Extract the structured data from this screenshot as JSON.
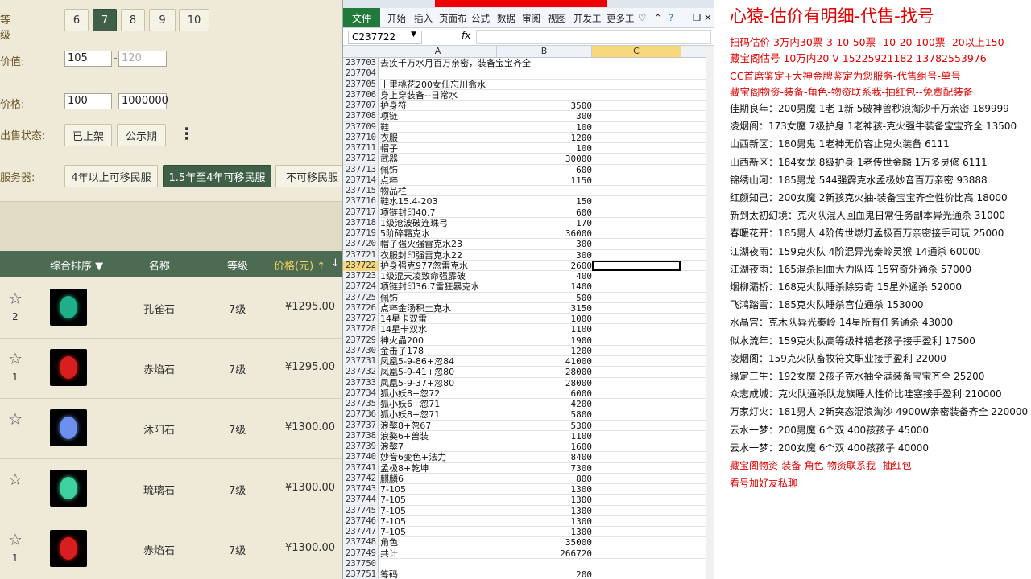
{
  "filters": {
    "level_label": "等级",
    "level_options": [
      "6",
      "7",
      "8",
      "9",
      "10"
    ],
    "level_selected": "7",
    "value_label": "价值:",
    "value_min": "105",
    "value_max_placeholder": "120",
    "price_label": "价格:",
    "price_min": "100",
    "price_max": "1000000",
    "sale_status_label": "出售状态:",
    "sale_status_options": [
      "已上架",
      "公示期"
    ],
    "more_icon": "vertical-dots-icon",
    "server_label": "服务器:",
    "server_options": [
      "4年以上可移民服",
      "1.5年至4年可移民服",
      "不可移民服"
    ],
    "server_selected": "1.5年至4年可移民服",
    "range_separator": "-"
  },
  "table": {
    "headers": {
      "sort": "综合排序",
      "name": "名称",
      "level": "等级",
      "price": "价格(元)"
    },
    "rows": [
      {
        "fav_count": "2",
        "name": "孔雀石",
        "level": "7级",
        "price": "¥1295.00",
        "gem_color": "#1fae8a"
      },
      {
        "fav_count": "1",
        "name": "赤焰石",
        "level": "7级",
        "price": "¥1295.00",
        "gem_color": "#d81e1e"
      },
      {
        "fav_count": "",
        "name": "沐阳石",
        "level": "7级",
        "price": "¥1300.00",
        "gem_color": "#6c8ff0"
      },
      {
        "fav_count": "",
        "name": "琉璃石",
        "level": "7级",
        "price": "¥1300.00",
        "gem_color": "#3fd0a0"
      },
      {
        "fav_count": "1",
        "name": "赤焰石",
        "level": "7级",
        "price": "¥1300.00",
        "gem_color": "#d81e1e"
      }
    ]
  },
  "excel": {
    "ribbon_tabs": [
      "文件",
      "开始",
      "插入",
      "页面布",
      "公式",
      "数据",
      "审阅",
      "视图",
      "开发工",
      "更多工"
    ],
    "name_box": "C237722",
    "fx": "fx",
    "columns": [
      "A",
      "B",
      "C"
    ],
    "active_row": "237722",
    "rows": [
      [
        "237703",
        "去疾千万水月百万亲密，装备宝宝齐全",
        ""
      ],
      [
        "237704",
        "",
        ""
      ],
      [
        "237705",
        "十里桃花200女仙忘川翕水",
        ""
      ],
      [
        "237706",
        "身上穿装备--日常水",
        ""
      ],
      [
        "237707",
        "护身符",
        "3500"
      ],
      [
        "237708",
        "项链",
        "300"
      ],
      [
        "237709",
        "鞋",
        "100"
      ],
      [
        "237710",
        "衣服",
        "1200"
      ],
      [
        "237711",
        "帽子",
        "100"
      ],
      [
        "237712",
        "武器",
        "30000"
      ],
      [
        "237713",
        "佩饰",
        "600"
      ],
      [
        "237714",
        "点粹",
        "1150"
      ],
      [
        "237715",
        "物品栏",
        ""
      ],
      [
        "237716",
        "鞋水15.4-203",
        "150"
      ],
      [
        "237717",
        "项链封印40.7",
        "600"
      ],
      [
        "237718",
        "1级沧波破连珠弓",
        "170"
      ],
      [
        "237719",
        "5阶碎霜克水",
        "36000"
      ],
      [
        "237720",
        "帽子强火强雷克水23",
        "300"
      ],
      [
        "237721",
        "衣服封印强雷克水22",
        "300"
      ],
      [
        "237722",
        "护身强克977忽雷克水",
        "2600"
      ],
      [
        "237723",
        "1级混天凌致命强霹破",
        "400"
      ],
      [
        "237724",
        "项链封印36.7雷狂暴克水",
        "1400"
      ],
      [
        "237725",
        "佩饰",
        "500"
      ],
      [
        "237726",
        "点粹金汤积土克水",
        "3150"
      ],
      [
        "237727",
        "14星卡双雷",
        "1000"
      ],
      [
        "237728",
        "14星卡双水",
        "1100"
      ],
      [
        "237729",
        "神火畾200",
        "1900"
      ],
      [
        "237730",
        "金击子178",
        "1200"
      ],
      [
        "237731",
        "凤凰5-9-86+忽84",
        "41000"
      ],
      [
        "237732",
        "凤凰5-9-41+忽80",
        "28000"
      ],
      [
        "237733",
        "凤凰5-9-37+忽80",
        "28000"
      ],
      [
        "237734",
        "狐小妖8+忽72",
        "6000"
      ],
      [
        "237735",
        "狐小妖6+忽71",
        "4200"
      ],
      [
        "237736",
        "狐小妖8+忽71",
        "5800"
      ],
      [
        "237737",
        "浪獒8+忽67",
        "5300"
      ],
      [
        "237738",
        "浪獒6+兽装",
        "1100"
      ],
      [
        "237739",
        "浪獒7",
        "1600"
      ],
      [
        "237740",
        "妙音6变色+法力",
        "8400"
      ],
      [
        "237741",
        "孟极8+乾坤",
        "7300"
      ],
      [
        "237742",
        "麒麟6",
        "800"
      ],
      [
        "237743",
        "7-105",
        "1300"
      ],
      [
        "237744",
        "7-105",
        "1300"
      ],
      [
        "237745",
        "7-105",
        "1300"
      ],
      [
        "237746",
        "7-105",
        "1300"
      ],
      [
        "237747",
        "7-105",
        "1300"
      ],
      [
        "237748",
        "角色",
        "35000"
      ],
      [
        "237749",
        "共计",
        "266720"
      ],
      [
        "237750",
        "",
        ""
      ],
      [
        "237751",
        "筹码",
        "200"
      ]
    ]
  },
  "notes": {
    "title": "心猿-估价有明细-代售-找号",
    "lines": [
      {
        "text": "扫码估价 3万内30票-3-10-50票--10-20-100票- 20以上150",
        "red": true
      },
      {
        "text": "藏宝阁估号 10万内20 V 15225921182   13782553976",
        "red": true
      },
      {
        "text": "CC首席鉴定+大神金牌鉴定为您服务-代售组号-单号",
        "red": true
      },
      {
        "text": "藏宝阁物资-装备-角色-物资联系我-抽红包--免费配装备",
        "red": true
      },
      {
        "text": "佳期良年：200男魔 1老 1新 5破神兽秒浪淘沙千万亲密 189999",
        "red": false
      },
      {
        "text": "凌烟阁：173女魔 7级护身 1老神孩-克火强牛装备宝宝齐全 13500",
        "red": false
      },
      {
        "text": "山西新区：180男鬼 1老神无价容止鬼火装备 6111",
        "red": false
      },
      {
        "text": "山西新区：184女龙 8级护身 1老传世金麟 1万多灵修 6111",
        "red": false
      },
      {
        "text": "锦绣山河：185男龙 544强霹克水孟极妙音百万亲密 93888",
        "red": false
      },
      {
        "text": "红颜知己：200女魔 2新孩克火抽-装备宝宝齐全性价比高 18000",
        "red": false
      },
      {
        "text": "新到太初幻境：克火队混人回血鬼日常任务副本异光通杀 31000",
        "red": false
      },
      {
        "text": "春暖花开：185男人 4阶传世燃灯孟极百万亲密接手可玩 25000",
        "red": false
      },
      {
        "text": "江湖夜雨：159克火队 4阶混异光秦岭灵猴 14通杀 60000",
        "red": false
      },
      {
        "text": "江湖夜雨：165混杀回血大力队阵 15穷奇外通杀 57000",
        "red": false
      },
      {
        "text": "烟柳灞桥：168克火队睡杀除穷奇 15星外通杀 52000",
        "red": false
      },
      {
        "text": "飞鸿踏雪：185克火队睡杀宫位通杀 153000",
        "red": false
      },
      {
        "text": "水晶宫：克木队异光秦岭 14星所有任务通杀 43000",
        "red": false
      },
      {
        "text": "似水流年：159克火队高等级神禧老孩子接手盈利 17500",
        "red": false
      },
      {
        "text": "凌烟阁：159克火队畜牧符文职业接手盈利 22000",
        "red": false
      },
      {
        "text": "缘定三生：192女魔 2孩子克水抽全满装备宝宝齐全 25200",
        "red": false
      },
      {
        "text": "众志成城：克火队通杀队龙族睡人性价比哇塞接手盈利 210000",
        "red": false
      },
      {
        "text": "万家灯火：181男人 2新突态混浪淘沙 4900W亲密装备齐全 220000",
        "red": false
      },
      {
        "text": "云水一梦：200男魔 6个双 400孩孩子 45000",
        "red": false
      },
      {
        "text": "云水一梦：200女魔 6个双 400孩孩子 40000",
        "red": false
      },
      {
        "text": "藏宝阁物资-装备-角色-物资联系我--抽红包",
        "red": true
      },
      {
        "text": "看号加好友私聊",
        "red": true
      }
    ]
  }
}
